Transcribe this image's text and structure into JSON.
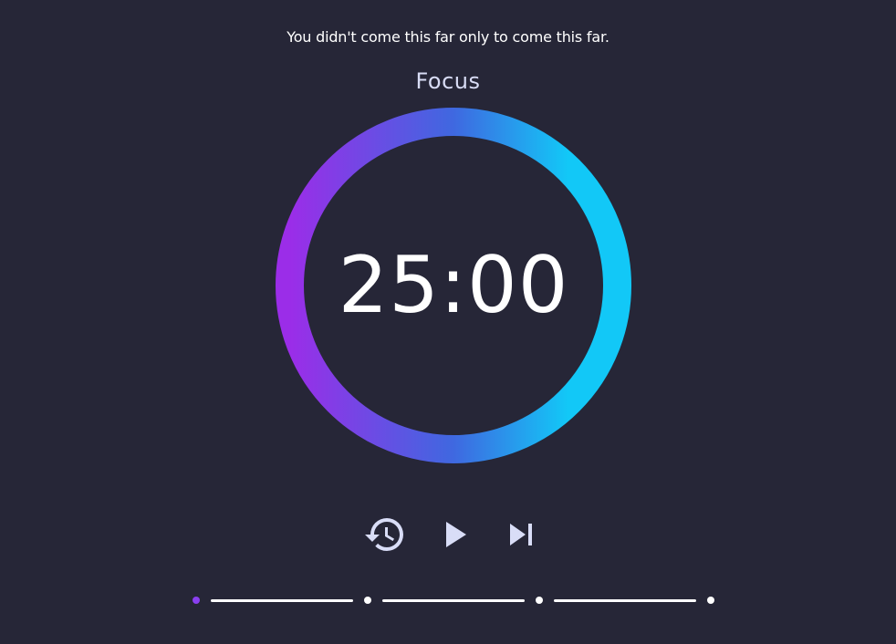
{
  "quote": "You didn't come this far only to come this far.",
  "mode_label": "Focus",
  "timer": {
    "display": "25:00",
    "ring_gradient_colors": [
      "#9b2de8",
      "#3f68e0",
      "#12c8f7"
    ]
  },
  "controls": {
    "reset_icon": "history-icon",
    "play_icon": "play-icon",
    "skip_icon": "skip-next-icon",
    "icon_color": "#d9ddf7"
  },
  "session_progress": {
    "total_sessions": 4,
    "current_session": 1,
    "active_color": "#8a3ff0",
    "inactive_color": "#ffffff"
  },
  "colors": {
    "background": "#262637",
    "text": "#ffffff"
  }
}
